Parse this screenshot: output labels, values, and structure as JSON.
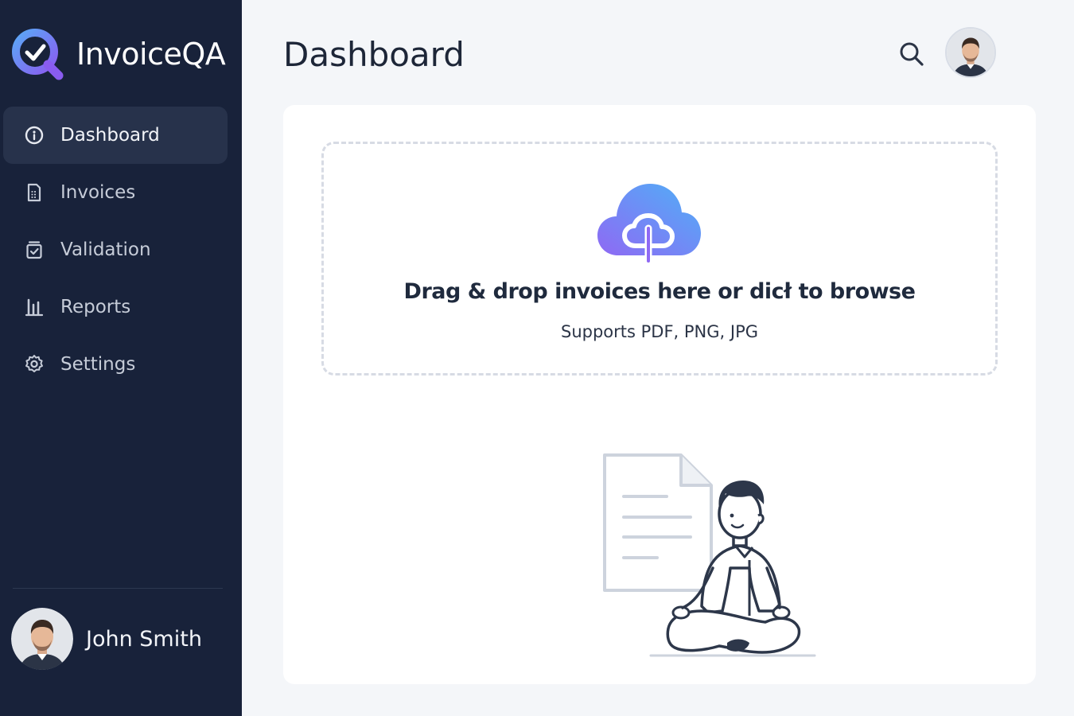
{
  "app": {
    "name": "InvoiceQA"
  },
  "sidebar": {
    "items": [
      {
        "label": "Dashboard",
        "icon": "dashboard-icon",
        "active": true
      },
      {
        "label": "Invoices",
        "icon": "invoice-icon",
        "active": false
      },
      {
        "label": "Validation",
        "icon": "validation-icon",
        "active": false
      },
      {
        "label": "Reports",
        "icon": "bar-chart-icon",
        "active": false
      },
      {
        "label": "Settings",
        "icon": "gear-icon",
        "active": false
      }
    ],
    "user": {
      "name": "John Smith"
    }
  },
  "header": {
    "title": "Dashboard",
    "search_icon": "search-icon"
  },
  "upload": {
    "title": "Drag & drop invoices here or dicł to browse",
    "subtitle": "Supports PDF, PNG, JPG",
    "icon": "cloud-upload-icon"
  },
  "colors": {
    "sidebar_bg": "#18223a",
    "active_item_bg": "#27324b",
    "accent_start": "#8b6cf6",
    "accent_end": "#4fa3f5",
    "page_bg": "#f4f6f9"
  }
}
